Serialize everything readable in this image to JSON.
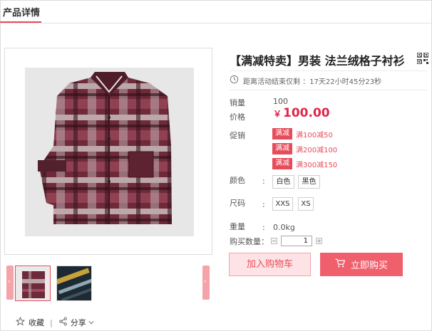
{
  "tab": {
    "label": "产品详情"
  },
  "product": {
    "title": "【满减特卖】男装 法兰绒格子衬衫",
    "countdown": "距离活动结束仅剩 ：17天22小时45分23秒",
    "sales_label": "销量",
    "sales_value": "100",
    "price_label": "价格",
    "price_symbol": "￥",
    "price_value": "100.00",
    "promo_label": "促销",
    "promos": [
      {
        "tag": "满减",
        "text": "满100减50"
      },
      {
        "tag": "满减",
        "text": "满200减100"
      },
      {
        "tag": "满减",
        "text": "满300减150"
      }
    ],
    "color_label": "颜色",
    "colors": [
      "白色",
      "黑色"
    ],
    "size_label": "尺码",
    "sizes": [
      "XXS",
      "XS"
    ],
    "weight_label": "重量",
    "weight_value": "0.0kg",
    "qty_label": "购买数量：",
    "qty_value": "1",
    "qty_minus": "−",
    "qty_plus": "+"
  },
  "actions": {
    "add_to_cart": "加入购物车",
    "buy_now": "立即购买",
    "favorite": "收藏",
    "share": "分享",
    "divider": "|"
  },
  "colors": {
    "accent": "#e74c5b",
    "price": "#e0264a",
    "buy_button": "#ef5f6c",
    "cart_button_bg": "#fde3e5"
  },
  "icons": {
    "favorite": "star-icon",
    "share": "share-icon",
    "clock": "clock-icon",
    "qr": "qr-code-icon",
    "cart": "cart-icon"
  }
}
